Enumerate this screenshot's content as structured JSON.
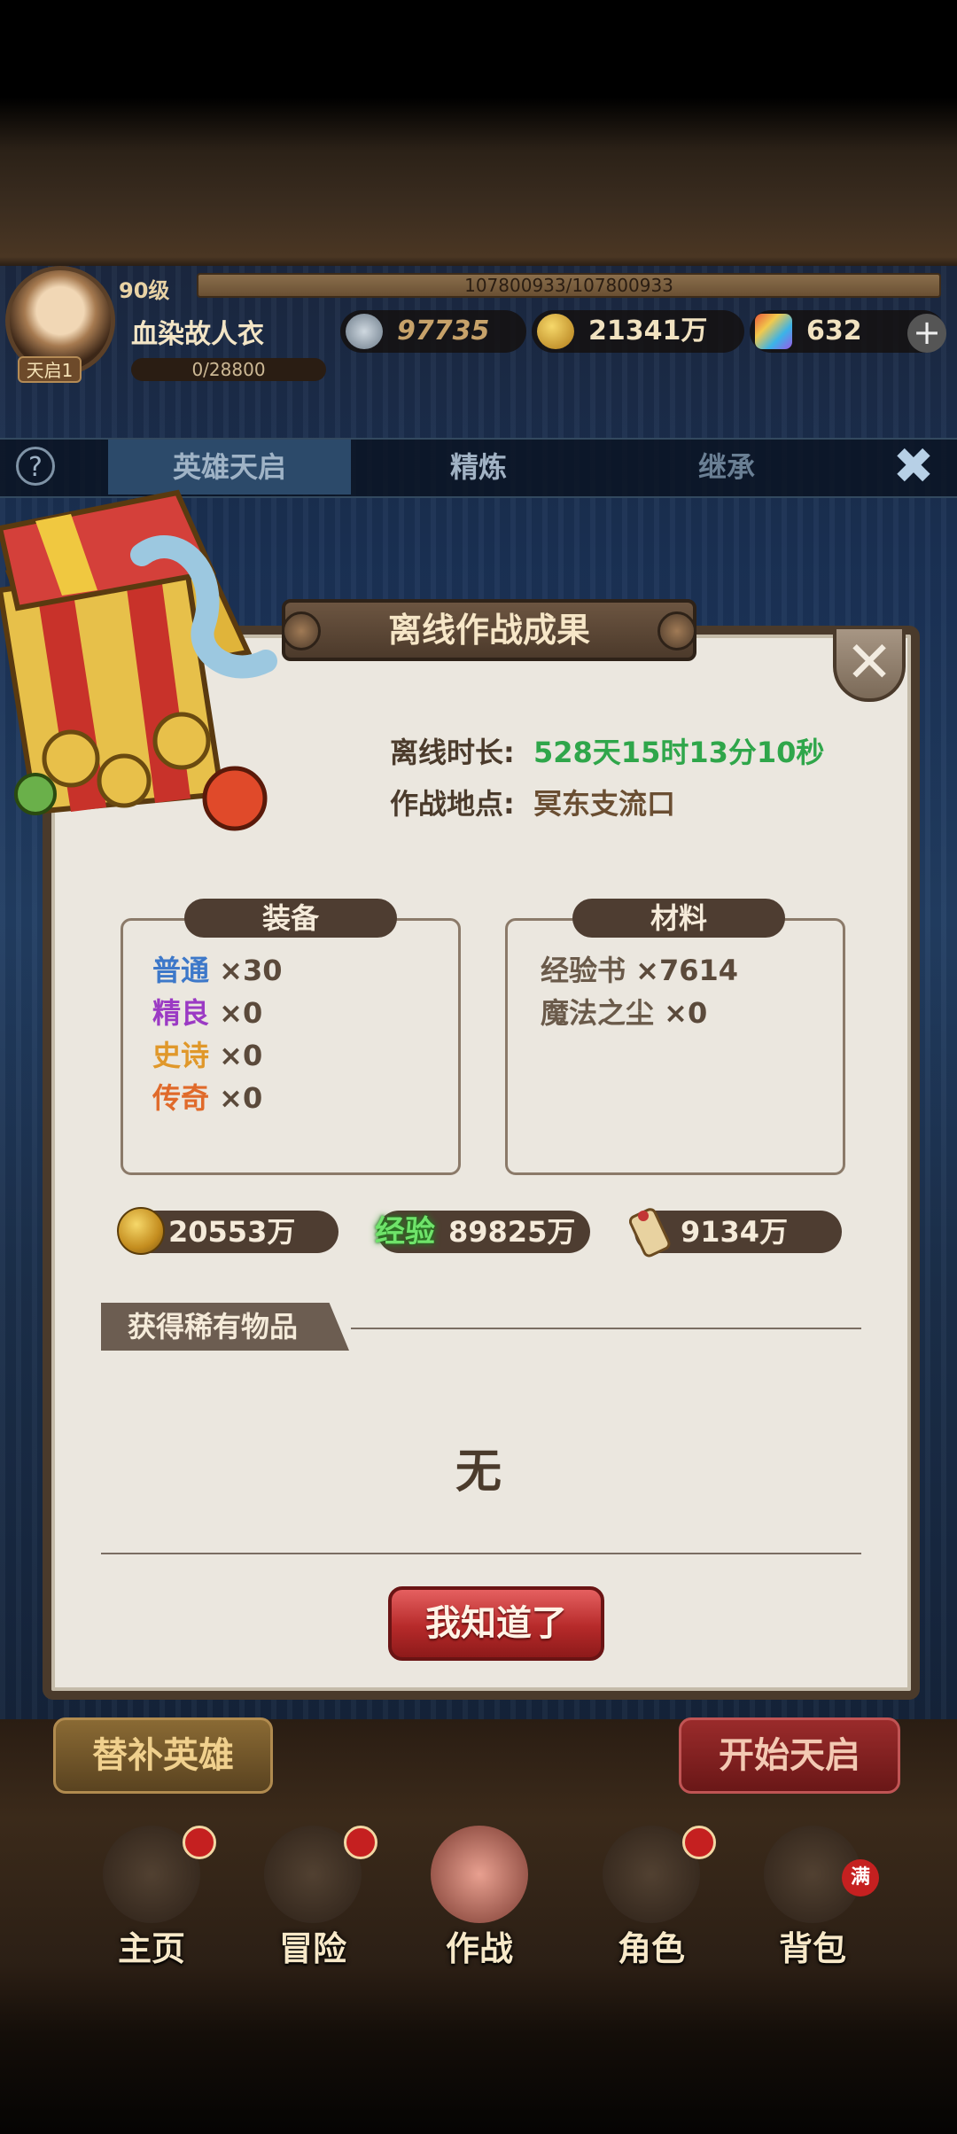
{
  "header": {
    "level": "90级",
    "hp": "107800933/107800933",
    "player_name": "血染故人衣",
    "avatar_badge": "天启1",
    "exp": "0/28800",
    "power": "97735",
    "gold": "21341万",
    "gems": "632",
    "plus": "+"
  },
  "tabs": {
    "help": "?",
    "items": [
      "英雄天启",
      "精炼",
      "继承"
    ],
    "close": "✖"
  },
  "modal": {
    "title": "离线作战成果",
    "close": "✕",
    "offline_label": "离线时长:",
    "offline_value": "528天15时13分10秒",
    "place_label": "作战地点:",
    "place_value": "冥东支流口",
    "equip_head": "装备",
    "equip": [
      {
        "name": "普通",
        "count": "×30",
        "color": "#3d78c9"
      },
      {
        "name": "精良",
        "count": "×0",
        "color": "#9b3ac4"
      },
      {
        "name": "史诗",
        "count": "×0",
        "color": "#e0982a"
      },
      {
        "name": "传奇",
        "count": "×0",
        "color": "#e06a2a"
      }
    ],
    "mat_head": "材料",
    "materials": [
      {
        "name": "经验书",
        "count": "×7614"
      },
      {
        "name": "魔法之尘",
        "count": "×0"
      }
    ],
    "res_gold": "20553万",
    "res_exp_tag": "经验",
    "res_exp": "89825万",
    "res_scroll": "9134万",
    "rare_title": "获得稀有物品",
    "rare_none": "无",
    "ok": "我知道了"
  },
  "buttons": {
    "substitute": "替补英雄",
    "start": "开始天启"
  },
  "nav": [
    "主页",
    "冒险",
    "作战",
    "角色",
    "背包"
  ],
  "full_badge": "满",
  "colors": {
    "offline_green": "#2fa64a",
    "ok_red": "#c23535"
  }
}
